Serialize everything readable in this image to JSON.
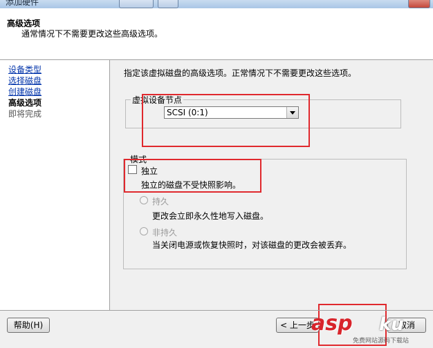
{
  "window": {
    "title": "添加硬件"
  },
  "header": {
    "title": "高级选项",
    "subtitle": "通常情况下不需要更改这些高级选项。"
  },
  "nav": {
    "items": [
      {
        "label": "设备类型",
        "state": "link"
      },
      {
        "label": "选择磁盘",
        "state": "link"
      },
      {
        "label": "创建磁盘",
        "state": "link"
      },
      {
        "label": "高级选项",
        "state": "current"
      },
      {
        "label": "即将完成",
        "state": "pending"
      }
    ]
  },
  "content": {
    "intro": "指定该虚拟磁盘的高级选项。正常情况下不需要更改这些选项。",
    "device_node": {
      "legend": "虚拟设备节点",
      "selected": "SCSI (0:1)"
    },
    "mode": {
      "legend": "模式",
      "independent": {
        "label": "独立",
        "checked": false,
        "description": "独立的磁盘不受快照影响。"
      },
      "persistent": {
        "label": "持久",
        "enabled": false,
        "description": "更改会立即永久性地写入磁盘。"
      },
      "nonpersistent": {
        "label": "非持久",
        "enabled": false,
        "description": "当关闭电源或恢复快照时，对该磁盘的更改会被丢弃。"
      }
    }
  },
  "footer": {
    "help_label": "帮助(H)",
    "back_label": "< 上一步",
    "cancel_label": "取消"
  },
  "annotations": {
    "highlight_color": "#e0282d"
  },
  "watermark": {
    "brand_left": "asp",
    "brand_right": "ku",
    "caption": "免费网站源码下载站"
  }
}
